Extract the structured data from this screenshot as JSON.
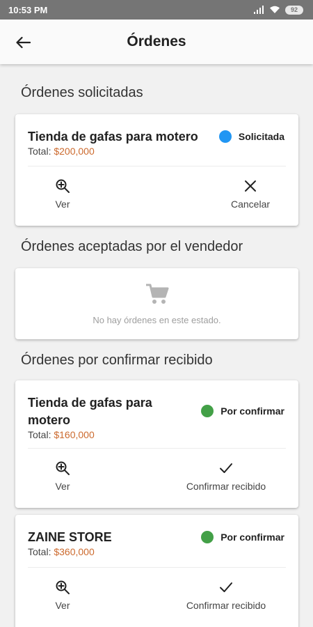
{
  "status_bar": {
    "time": "10:53 PM",
    "battery": "92"
  },
  "app_bar": {
    "title": "Órdenes"
  },
  "sections": {
    "requested": {
      "title": "Órdenes solicitadas",
      "order": {
        "store": "Tienda de gafas para motero",
        "total_label": "Total:",
        "total_value": "$200,000",
        "status": "Solicitada",
        "status_color": "#2196f3",
        "actions": {
          "view": "Ver",
          "cancel": "Cancelar"
        }
      }
    },
    "accepted": {
      "title": "Órdenes aceptadas por el vendedor",
      "empty_message": "No hay órdenes en este estado."
    },
    "to_confirm": {
      "title": "Órdenes por confirmar recibido",
      "orders": [
        {
          "store_line1": "Tienda de gafas para",
          "store_line2": "motero",
          "total_label": "Total:",
          "total_value": "$160,000",
          "status": "Por confirmar",
          "status_color": "#43a047",
          "actions": {
            "view": "Ver",
            "confirm": "Confirmar recibido"
          }
        },
        {
          "store": "ZAINE STORE",
          "total_label": "Total:",
          "total_value": "$360,000",
          "status": "Por confirmar",
          "status_color": "#43a047",
          "actions": {
            "view": "Ver",
            "confirm": "Confirmar recibido"
          }
        }
      ]
    }
  },
  "icons": {
    "back": "arrow-left-icon",
    "view": "zoom-in-icon",
    "cancel": "close-icon",
    "confirm": "check-icon",
    "empty": "shopping-cart-icon",
    "wifi": "wifi-icon",
    "signal": "signal-icon"
  },
  "colors": {
    "status_bar": "#757575",
    "amount": "#cc6a2e",
    "requested": "#2196f3",
    "to_confirm": "#43a047"
  }
}
